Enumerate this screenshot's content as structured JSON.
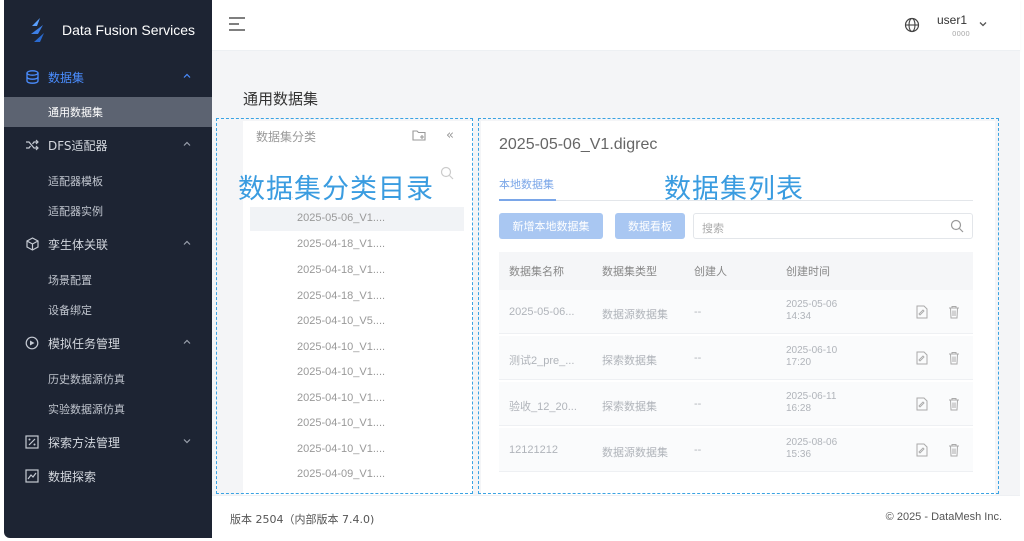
{
  "brand": {
    "name": "Data Fusion Services"
  },
  "sidebar": {
    "groups": [
      {
        "label": "数据集",
        "icon": "database-icon"
      },
      {
        "label": "DFS适配器",
        "icon": "shuffle-icon"
      },
      {
        "label": "孪生体关联",
        "icon": "cube-icon"
      },
      {
        "label": "模拟任务管理",
        "icon": "simulation-icon"
      },
      {
        "label": "探索方法管理",
        "icon": "percent-icon"
      },
      {
        "label": "数据探索",
        "icon": "chart-icon"
      }
    ],
    "subitems": [
      {
        "label": "通用数据集"
      },
      {
        "label": "适配器模板"
      },
      {
        "label": "适配器实例"
      },
      {
        "label": "场景配置"
      },
      {
        "label": "设备绑定"
      },
      {
        "label": "历史数据源仿真"
      },
      {
        "label": "实验数据源仿真"
      }
    ]
  },
  "header": {
    "user": "user1",
    "user_sub": "0000"
  },
  "page": {
    "title": "通用数据集"
  },
  "categories": {
    "header": "数据集分类",
    "hidden_text": "...",
    "annotation": "数据集分类目录",
    "items": [
      "2025-05-06_V1....",
      "2025-04-18_V1....",
      "2025-04-18_V1....",
      "2025-04-18_V1....",
      "2025-04-10_V5....",
      "2025-04-10_V1....",
      "2025-04-10_V1....",
      "2025-04-10_V1....",
      "2025-04-10_V1....",
      "2025-04-10_V1....",
      "2025-04-09_V1...."
    ]
  },
  "list": {
    "title": "2025-05-06_V1.digrec",
    "annotation": "数据集列表",
    "tab_local": "本地数据集",
    "btn_add": "新增本地数据集",
    "btn_board": "数据看板",
    "search_placeholder": "搜索",
    "columns": [
      "数据集名称",
      "数据集类型",
      "创建人",
      "创建时间"
    ],
    "rows": [
      {
        "name": "2025-05-06...",
        "type": "数据源数据集",
        "creator": "--",
        "date": "2025-05-06",
        "time": "14:34"
      },
      {
        "name": "测试2_pre_...",
        "type": "探索数据集",
        "creator": "--",
        "date": "2025-06-10",
        "time": "17:20"
      },
      {
        "name": "验收_12_20...",
        "type": "探索数据集",
        "creator": "--",
        "date": "2025-06-11",
        "time": "16:28"
      },
      {
        "name": "12121212",
        "type": "数据源数据集",
        "creator": "--",
        "date": "2025-08-06",
        "time": "15:36"
      }
    ]
  },
  "footer": {
    "version": "版本 2504（内部版本 7.4.0)",
    "copyright": "© 2025 - DataMesh Inc."
  },
  "colors": {
    "sidebar_bg": "#1d2433",
    "accent": "#4a8dff",
    "annotation": "#3a9ce0",
    "button": "#a9c7f2"
  }
}
